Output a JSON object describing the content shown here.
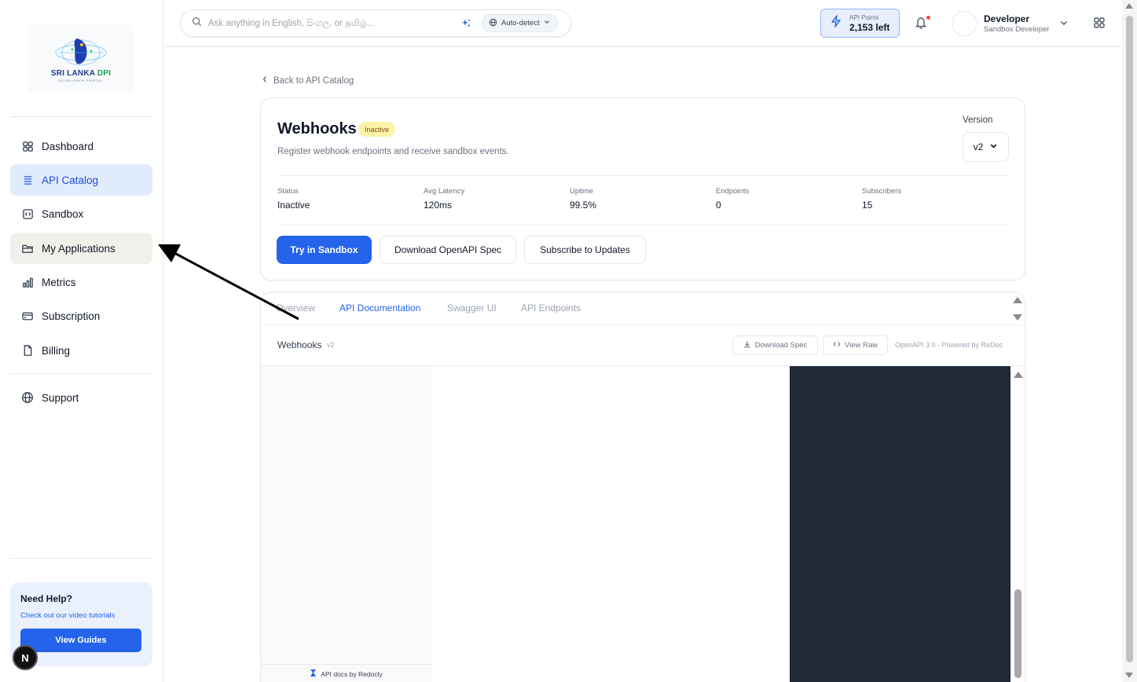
{
  "sidebar": {
    "logo": {
      "name": "SRI LANKA",
      "accent": "DPI",
      "sub": "DEVELOPER PORTAL"
    },
    "items": [
      {
        "label": "Dashboard",
        "icon": "grid-icon"
      },
      {
        "label": "API Catalog",
        "icon": "list-icon",
        "active": true
      },
      {
        "label": "Sandbox",
        "icon": "code-box-icon"
      },
      {
        "label": "My Applications",
        "icon": "folder-icon",
        "hover": true
      },
      {
        "label": "Metrics",
        "icon": "bar-chart-icon"
      },
      {
        "label": "Subscription",
        "icon": "credit-card-icon"
      },
      {
        "label": "Billing",
        "icon": "file-icon"
      }
    ],
    "support": {
      "label": "Support",
      "icon": "globe-icon"
    },
    "help": {
      "title": "Need Help?",
      "subtitle": "Check out our video tutorials",
      "button": "View Guides"
    },
    "badge": "N"
  },
  "header": {
    "search": {
      "placeholder": "Ask anything in English, සිංහල, or தமிழ்..."
    },
    "language": "Auto-detect",
    "points": {
      "label": "API Points",
      "value": "2,153 left"
    },
    "user": {
      "name": "Developer",
      "role": "Sandbox Developer"
    }
  },
  "main": {
    "back_link": "Back to API Catalog",
    "api": {
      "title": "Webhooks",
      "status_badge": "Inactive",
      "description": "Register webhook endpoints and receive sandbox events.",
      "version_label": "Version",
      "version": "v2"
    },
    "stats": [
      {
        "label": "Status",
        "value": "Inactive"
      },
      {
        "label": "Avg Latency",
        "value": "120ms"
      },
      {
        "label": "Uptime",
        "value": "99.5%"
      },
      {
        "label": "Endpoints",
        "value": "0"
      },
      {
        "label": "Subscribers",
        "value": "15"
      }
    ],
    "actions": {
      "try": "Try in Sandbox",
      "download": "Download OpenAPI Spec",
      "subscribe": "Subscribe to Updates"
    },
    "tabs": [
      {
        "label": "Overview"
      },
      {
        "label": "API Documentation",
        "active": true
      },
      {
        "label": "Swagger UI"
      },
      {
        "label": "API Endpoints"
      }
    ],
    "docs": {
      "name": "Webhooks",
      "version": "v2",
      "download_spec": "Download Spec",
      "view_raw": "View Raw",
      "powered_by": "OpenAPI 3.0 · Powered by ReDoc",
      "footer": "API docs by Redocly"
    }
  },
  "colors": {
    "accent": "#2563eb",
    "active_nav_bg": "#e0ebfb",
    "badge_inactive_bg": "#fdf3a7",
    "redoc_dark": "#1f2937"
  }
}
